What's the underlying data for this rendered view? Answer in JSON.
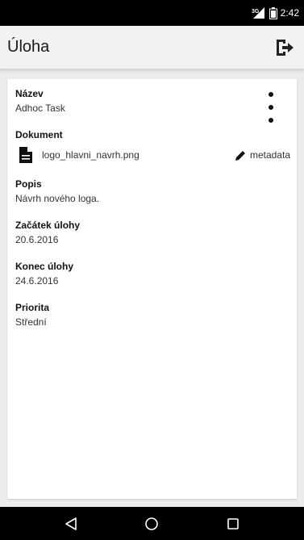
{
  "status_bar": {
    "network_label": "3G",
    "time": "2:42",
    "icons": [
      "signal-icon",
      "battery-icon"
    ]
  },
  "app_bar": {
    "title": "Úloha",
    "action_icon": "exit-icon"
  },
  "task": {
    "name_label": "Název",
    "name_value": "Adhoc Task",
    "document_label": "Dokument",
    "document_file": "logo_hlavni_navrh.png",
    "metadata_label": "metadata",
    "description_label": "Popis",
    "description_value": "Návrh nového loga.",
    "start_label": "Začátek úlohy",
    "start_value": "20.6.2016",
    "end_label": "Konec úlohy",
    "end_value": "24.6.2016",
    "priority_label": "Priorita",
    "priority_value": "Střední"
  },
  "nav_bar": {
    "icons": [
      "back-icon",
      "home-icon",
      "recents-icon"
    ]
  },
  "colors": {
    "background": "#ececec",
    "app_bar": "#f2f2f2",
    "card": "#ffffff",
    "bars": "#000000"
  }
}
